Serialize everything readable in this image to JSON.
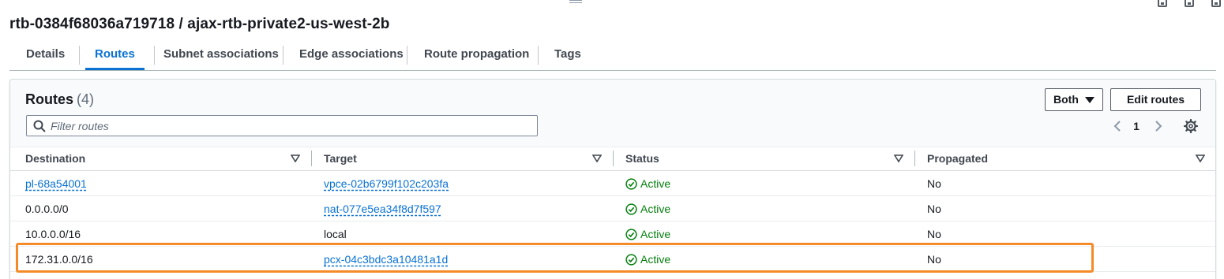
{
  "page": {
    "title": "rtb-0384f68036a719718 / ajax-rtb-private2-us-west-2b"
  },
  "tabs": [
    {
      "label": "Details",
      "active": false
    },
    {
      "label": "Routes",
      "active": true
    },
    {
      "label": "Subnet associations",
      "active": false
    },
    {
      "label": "Edge associations",
      "active": false
    },
    {
      "label": "Route propagation",
      "active": false
    },
    {
      "label": "Tags",
      "active": false
    }
  ],
  "routes_panel": {
    "heading": "Routes",
    "count": "(4)",
    "filter_placeholder": "Filter routes",
    "filter_value": "",
    "both_label": "Both",
    "edit_routes_label": "Edit routes",
    "current_page": "1",
    "columns": [
      "Destination",
      "Target",
      "Status",
      "Propagated"
    ],
    "rows": [
      {
        "destination": "pl-68a54001",
        "destination_is_link": true,
        "target": "vpce-02b6799f102c203fa",
        "target_is_link": true,
        "status": "Active",
        "propagated": "No"
      },
      {
        "destination": "0.0.0.0/0",
        "destination_is_link": false,
        "target": "nat-077e5ea34f8d7f597",
        "target_is_link": true,
        "status": "Active",
        "propagated": "No"
      },
      {
        "destination": "10.0.0.0/16",
        "destination_is_link": false,
        "target": "local",
        "target_is_link": false,
        "status": "Active",
        "propagated": "No"
      },
      {
        "destination": "172.31.0.0/16",
        "destination_is_link": false,
        "target": "pcx-04c3bdc3a10481a1d",
        "target_is_link": true,
        "status": "Active",
        "propagated": "No"
      }
    ],
    "highlighted_row_index": 3
  },
  "icons": {
    "search": "search-icon",
    "caret": "caret-down-icon",
    "prev": "chevron-left-icon",
    "next": "chevron-right-icon",
    "settings": "gear-icon",
    "sort": "sort-down-icon",
    "status": "check-circle-icon"
  },
  "colors": {
    "link": "#0972d3",
    "status_active": "#037f0c",
    "highlight": "#f58a28",
    "active_tab": "#0972d3"
  }
}
